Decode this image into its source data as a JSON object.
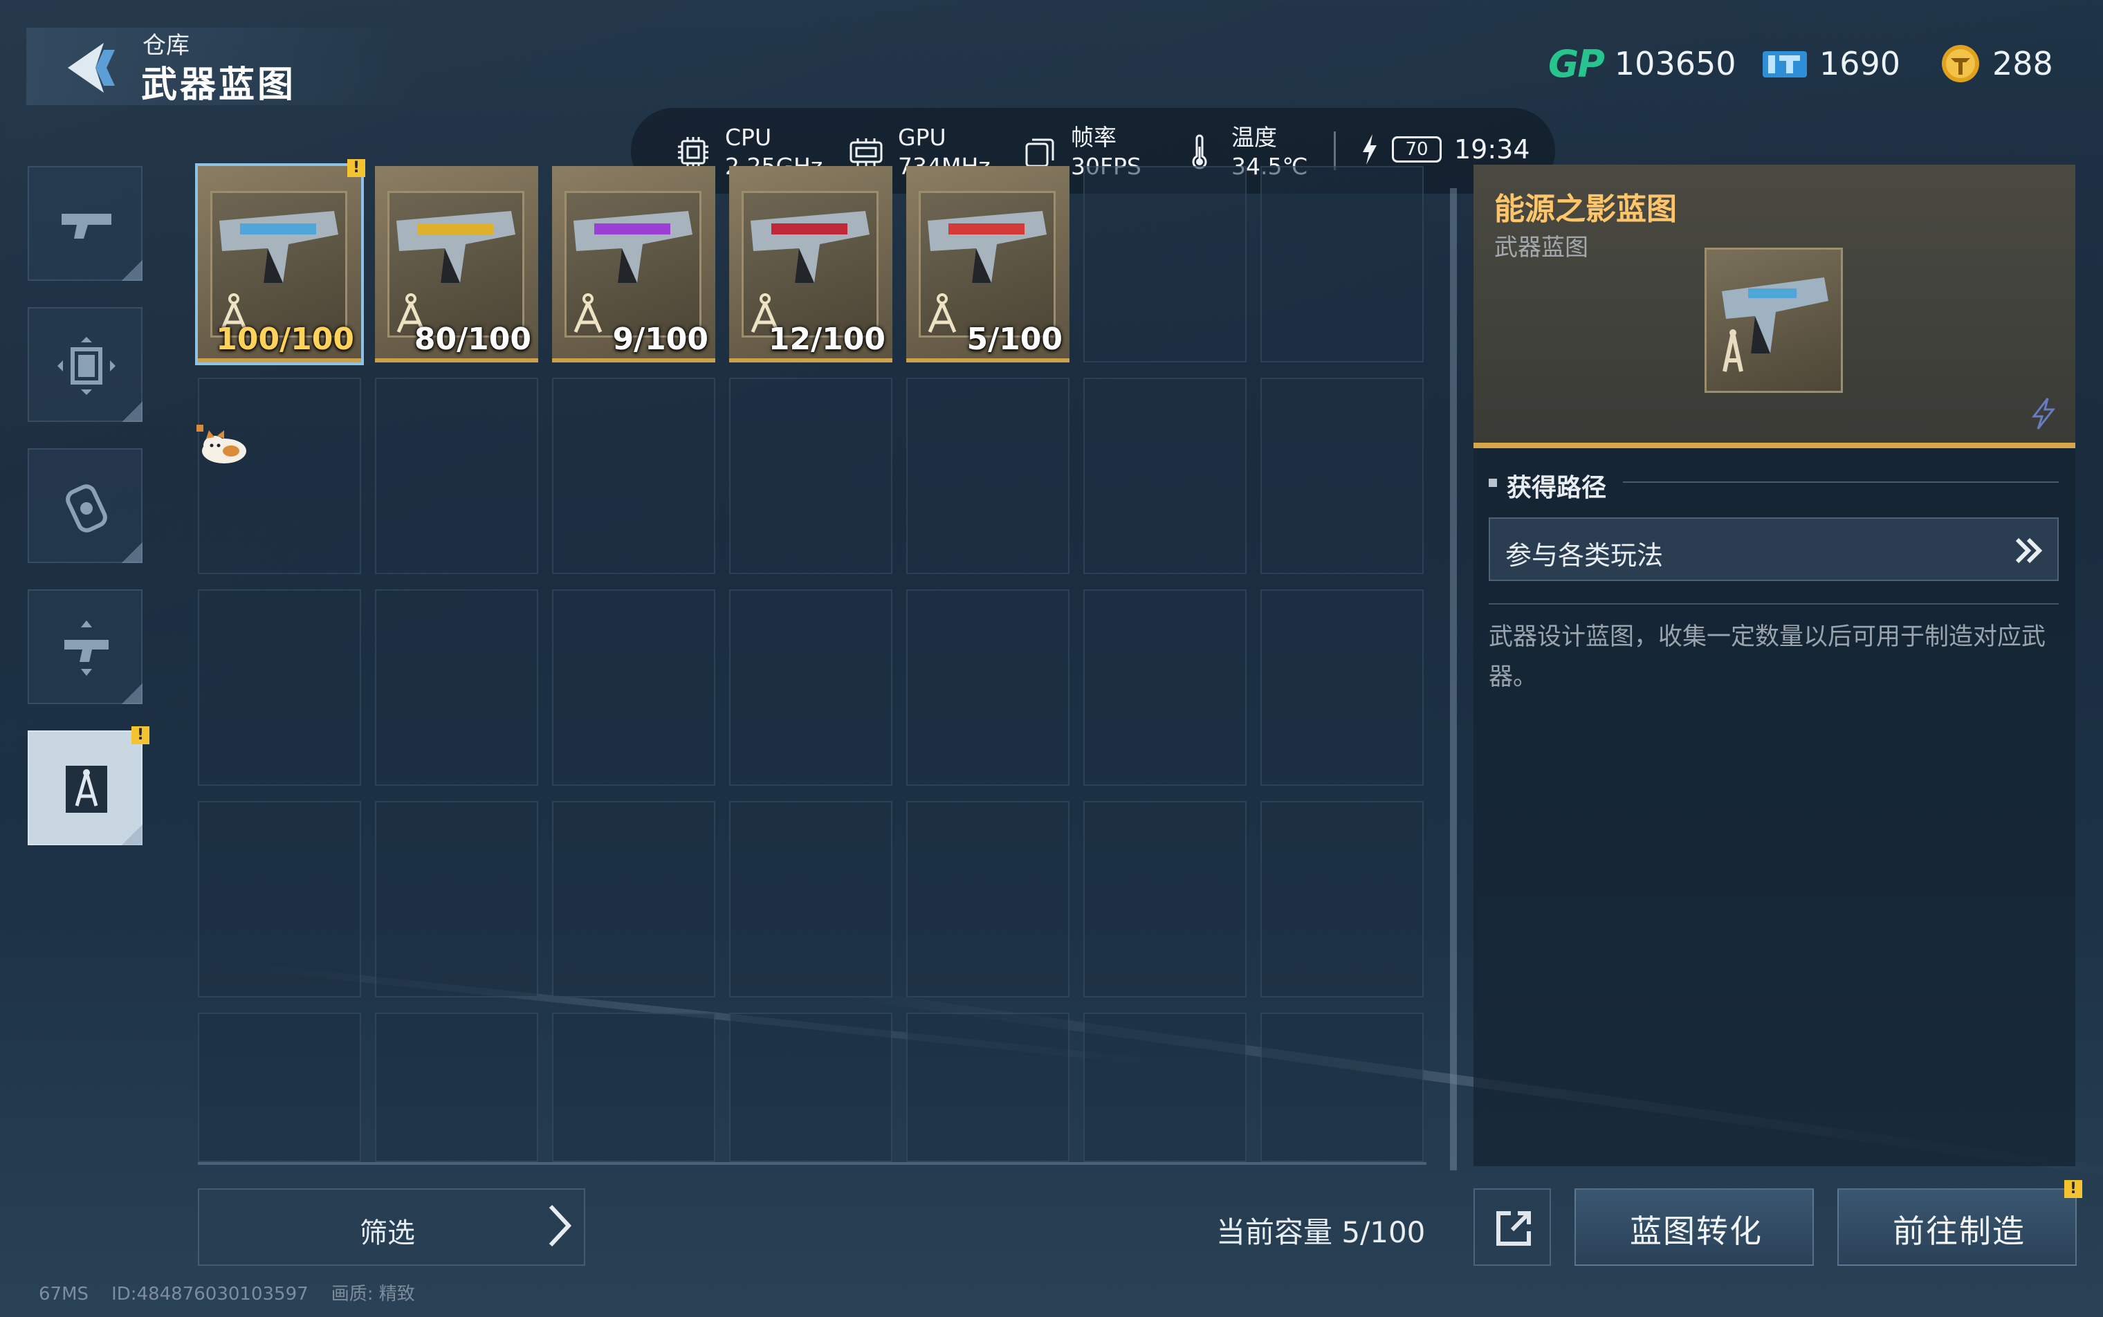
{
  "header": {
    "title_small": "仓库",
    "title_big": "武器蓝图"
  },
  "currencies": [
    {
      "icon": "gp-icon",
      "badge": "GP",
      "value": "103650"
    },
    {
      "icon": "ticket-icon",
      "value": "1690"
    },
    {
      "icon": "coin-icon",
      "value": "288"
    }
  ],
  "perf": {
    "cpu_label": "CPU",
    "cpu_value": "2.25GHz",
    "gpu_label": "GPU",
    "gpu_value": "734MHz",
    "fps_label": "帧率",
    "fps_value": "30FPS",
    "temp_label": "温度",
    "temp_value": "34.5℃",
    "battery": "70",
    "time": "19:34"
  },
  "tabs": [
    {
      "icon": "pistol-icon",
      "active": false
    },
    {
      "icon": "frame-icon",
      "active": false
    },
    {
      "icon": "grenade-icon",
      "active": false
    },
    {
      "icon": "weapon-mod-icon",
      "active": false
    },
    {
      "icon": "blueprint-icon",
      "active": true,
      "alert": "!"
    }
  ],
  "items": [
    {
      "count": "100/100",
      "full": true,
      "color": "#4fa6d8",
      "selected": true,
      "alert": "!"
    },
    {
      "count": "80/100",
      "full": false,
      "color": "#e0b02a"
    },
    {
      "count": "9/100",
      "full": false,
      "color": "#9b3fd4"
    },
    {
      "count": "12/100",
      "full": false,
      "color": "#c0283a"
    },
    {
      "count": "5/100",
      "full": false,
      "color": "#d43a3a"
    }
  ],
  "detail": {
    "name": "能源之影蓝图",
    "subtitle": "武器蓝图",
    "section_title": "获得路径",
    "obtain_label": "参与各类玩法",
    "description": "武器设计蓝图，收集一定数量以后可用于制造对应武器。"
  },
  "bottom": {
    "filter_label": "筛选",
    "capacity": "当前容量 5/100",
    "convert_label": "蓝图转化",
    "craft_label": "前往制造",
    "craft_alert": "!"
  },
  "footer": {
    "ms": "67MS",
    "id": "ID:484876030103597",
    "quality": "画质:  精致"
  }
}
